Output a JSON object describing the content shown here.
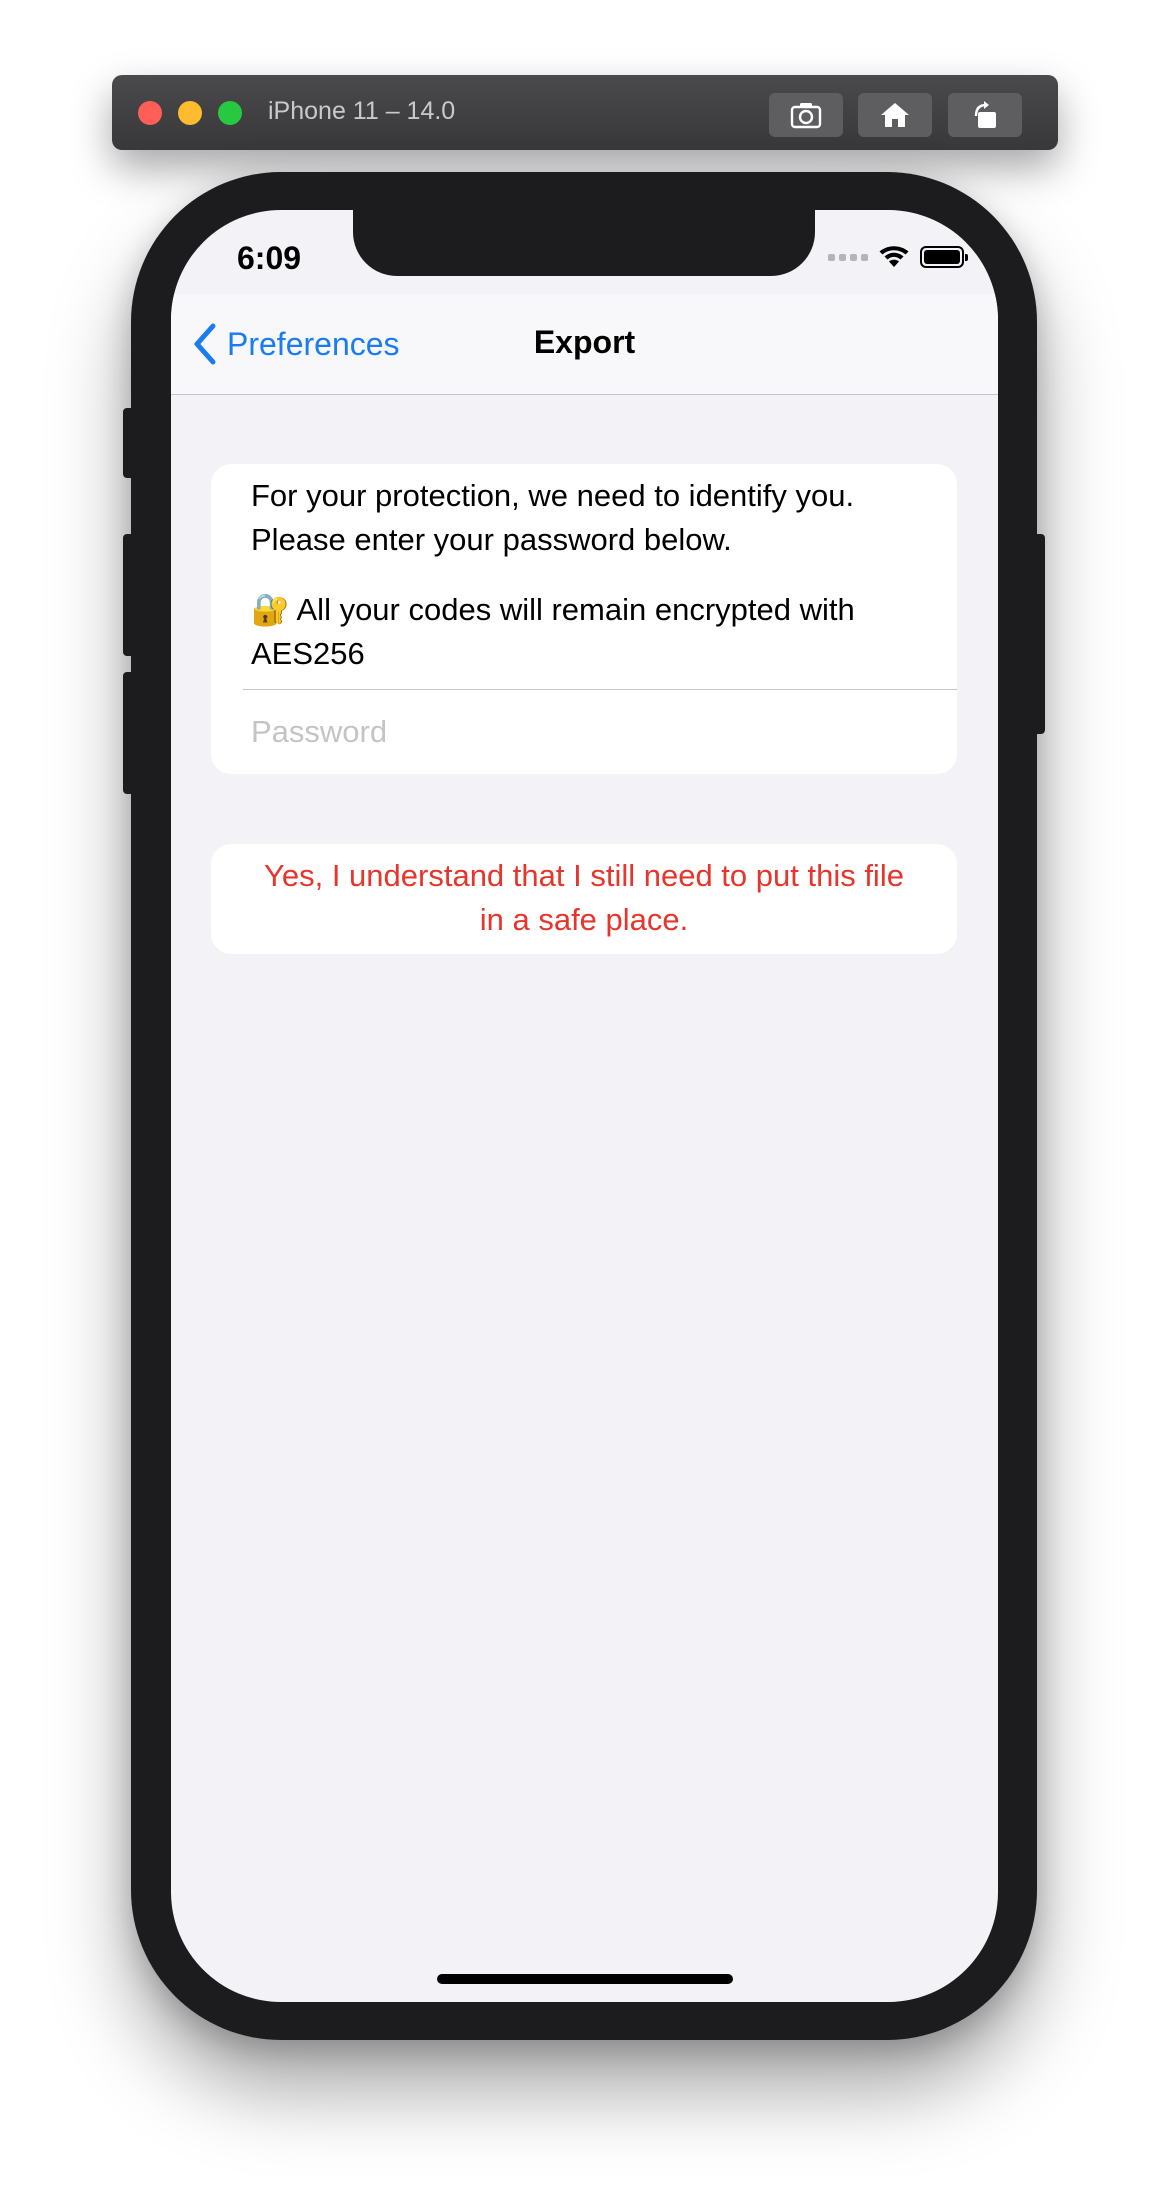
{
  "simulator": {
    "title": "iPhone 11 – 14.0",
    "buttons": [
      "screenshot-icon",
      "home-icon",
      "rotate-icon"
    ]
  },
  "status_bar": {
    "time": "6:09"
  },
  "nav": {
    "back_label": "Preferences",
    "title": "Export"
  },
  "form": {
    "intro": "For your protection, we need to identify you. Please enter your password below.",
    "encryption_note": "🔐 All your codes will remain encrypted with AES256",
    "password_placeholder": "Password",
    "password_value": ""
  },
  "confirm": {
    "label": "Yes, I understand that I still need to put this file in a safe place."
  },
  "colors": {
    "accent": "#1a7cf0",
    "destructive": "#e8352b",
    "background": "#f2f2f7"
  }
}
